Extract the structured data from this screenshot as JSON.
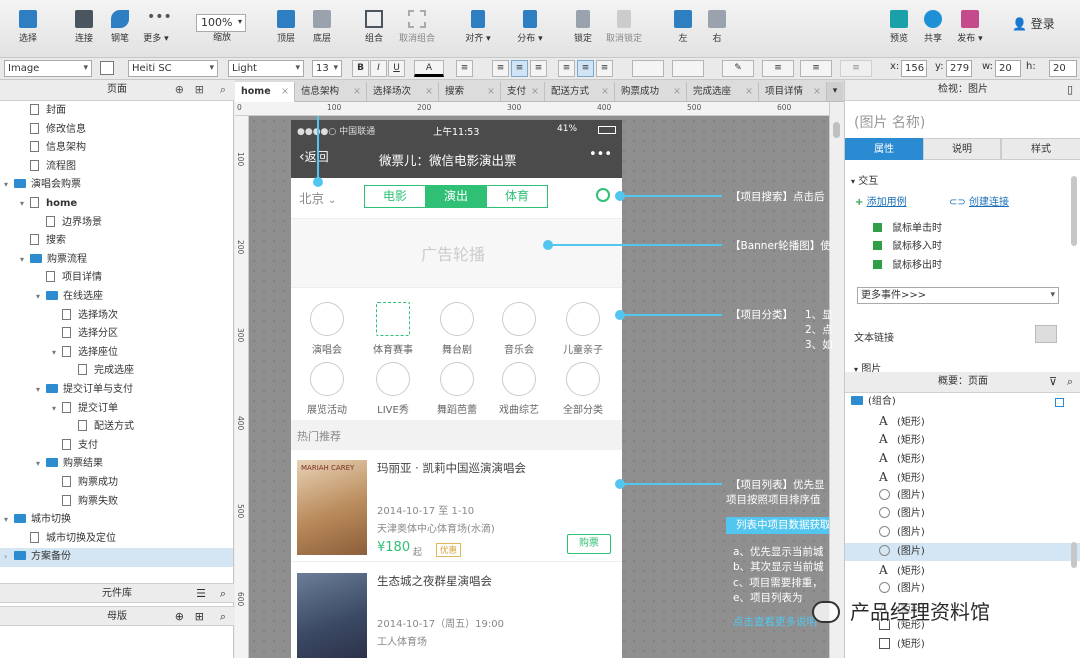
{
  "toolbar": {
    "tools": [
      {
        "label": "选择"
      },
      {
        "label": "连接"
      },
      {
        "label": "钢笔"
      },
      {
        "label": "更多 ▾"
      }
    ],
    "zoom_value": "100%",
    "zoom_label": "缩放",
    "arrange": [
      {
        "label": "顶层"
      },
      {
        "label": "底层"
      },
      {
        "label": "组合"
      },
      {
        "label": "取消组合"
      },
      {
        "label": "对齐 ▾"
      },
      {
        "label": "分布 ▾"
      },
      {
        "label": "锁定"
      },
      {
        "label": "取消锁定"
      },
      {
        "label": "左"
      },
      {
        "label": "右"
      }
    ],
    "actions": [
      {
        "label": "预览"
      },
      {
        "label": "共享"
      },
      {
        "label": "发布 ▾"
      }
    ],
    "login": "登录"
  },
  "format_bar": {
    "widget_type": "Image",
    "font": "Heiti SC",
    "weight": "Light",
    "size": "13",
    "bold": "B",
    "italic": "I",
    "underline": "U",
    "color": "A",
    "x_label": "x:",
    "x": "156",
    "y_label": "y:",
    "y": "279",
    "w_label": "w:",
    "w": "20",
    "h_label": "h:",
    "h": "20"
  },
  "left_panel": {
    "pages_title": "页面",
    "tree": [
      {
        "label": "封面",
        "indent": 1,
        "kind": "page",
        "expand": ""
      },
      {
        "label": "修改信息",
        "indent": 1,
        "kind": "page",
        "expand": ""
      },
      {
        "label": "信息架构",
        "indent": 1,
        "kind": "page",
        "expand": ""
      },
      {
        "label": "流程图",
        "indent": 1,
        "kind": "page",
        "expand": ""
      },
      {
        "label": "演唱会购票",
        "indent": 0,
        "kind": "folder",
        "expand": "▾"
      },
      {
        "label": "home",
        "indent": 1,
        "kind": "page",
        "expand": "▾",
        "bold": true
      },
      {
        "label": "边界场景",
        "indent": 2,
        "kind": "page",
        "expand": ""
      },
      {
        "label": "搜索",
        "indent": 1,
        "kind": "page",
        "expand": ""
      },
      {
        "label": "购票流程",
        "indent": 1,
        "kind": "folder",
        "expand": "▾"
      },
      {
        "label": "项目详情",
        "indent": 2,
        "kind": "page",
        "expand": ""
      },
      {
        "label": "在线选座",
        "indent": 2,
        "kind": "folder",
        "expand": "▾"
      },
      {
        "label": "选择场次",
        "indent": 3,
        "kind": "page",
        "expand": ""
      },
      {
        "label": "选择分区",
        "indent": 3,
        "kind": "page",
        "expand": ""
      },
      {
        "label": "选择座位",
        "indent": 3,
        "kind": "page",
        "expand": "▾"
      },
      {
        "label": "完成选座",
        "indent": 4,
        "kind": "page",
        "expand": ""
      },
      {
        "label": "提交订单与支付",
        "indent": 2,
        "kind": "folder",
        "expand": "▾"
      },
      {
        "label": "提交订单",
        "indent": 3,
        "kind": "page",
        "expand": "▾"
      },
      {
        "label": "配送方式",
        "indent": 4,
        "kind": "page",
        "expand": ""
      },
      {
        "label": "支付",
        "indent": 3,
        "kind": "page",
        "expand": ""
      },
      {
        "label": "购票结果",
        "indent": 2,
        "kind": "folder",
        "expand": "▾"
      },
      {
        "label": "购票成功",
        "indent": 3,
        "kind": "page",
        "expand": ""
      },
      {
        "label": "购票失败",
        "indent": 3,
        "kind": "page",
        "expand": ""
      },
      {
        "label": "城市切换",
        "indent": 0,
        "kind": "folder",
        "expand": "▾"
      },
      {
        "label": "城市切换及定位",
        "indent": 1,
        "kind": "page",
        "expand": ""
      },
      {
        "label": "方案备份",
        "indent": 0,
        "kind": "folder",
        "expand": "›",
        "selected": true
      }
    ],
    "library_title": "元件库",
    "masters_title": "母版"
  },
  "tabs": [
    {
      "label": "home",
      "active": true
    },
    {
      "label": "信息架构"
    },
    {
      "label": "选择场次"
    },
    {
      "label": "搜索"
    },
    {
      "label": "支付"
    },
    {
      "label": "配送方式"
    },
    {
      "label": "购票成功"
    },
    {
      "label": "完成选座"
    },
    {
      "label": "项目详情"
    }
  ],
  "ruler": {
    "h_ticks": [
      "0",
      "100",
      "200",
      "300",
      "400",
      "500",
      "600"
    ],
    "v_ticks": [
      "100",
      "200",
      "300",
      "400",
      "500",
      "600"
    ]
  },
  "phone": {
    "status_carrier": "●●●●○ 中国联通",
    "status_time": "上午11:53",
    "status_battery": "41%",
    "back": "返回",
    "title": "微票儿：微信电影演出票",
    "more": "•••",
    "city": "北京",
    "segments": [
      "电影",
      "演出",
      "体育"
    ],
    "banner": "广告轮播",
    "categories_row1": [
      "演唱会",
      "体育赛事",
      "舞台剧",
      "音乐会",
      "儿童亲子"
    ],
    "categories_row2": [
      "展览活动",
      "LIVE秀",
      "舞蹈芭蕾",
      "戏曲综艺",
      "全部分类"
    ],
    "section": "热门推荐",
    "items": [
      {
        "title": "玛丽亚 · 凯莉中国巡演演唱会",
        "date": "2014-10-17 至 1-10",
        "venue": "天津奥体中心体育场(水滴)",
        "price": "¥180",
        "price_suffix": "起",
        "badge": "优惠",
        "buy": "购票",
        "poster": "MARIAH CAREY"
      },
      {
        "title": "生态城之夜群星演唱会",
        "date": "2014-10-17（周五）19:00",
        "venue": "工人体育场"
      }
    ]
  },
  "annotations": {
    "search": "【项目搜索】点击后",
    "banner": "【Banner轮播图】使",
    "category_title": "【项目分类】",
    "category_lines": [
      "1、显",
      "2、点",
      "3、如"
    ],
    "list_line1": "【项目列表】优先显",
    "list_line2": "项目按照项目排序值",
    "list_box": "列表中项目数据获取",
    "list_rules": [
      "a、优先显示当前城",
      "b、其次显示当前城",
      "c、项目需要排重，",
      "e、项目列表为"
    ],
    "list_link": "点击查看更多说明"
  },
  "watermark": "产品经理资料馆",
  "right_panel": {
    "inspector_title": "检视：图片",
    "image_name": "(图片 名称)",
    "tabs": [
      "属性",
      "说明",
      "样式"
    ],
    "interaction": "交互",
    "add_case": "添加用例",
    "create_link": "创建连接",
    "events": [
      "鼠标单击时",
      "鼠标移入时",
      "鼠标移出时"
    ],
    "more_events": "更多事件>>>",
    "text_link": "文本链接",
    "image_section": "图片",
    "outline_title": "概要：页面",
    "outline": [
      {
        "label": "(组合)",
        "kind": "folder"
      },
      {
        "label": "(矩形)",
        "kind": "A"
      },
      {
        "label": "(矩形)",
        "kind": "A"
      },
      {
        "label": "(矩形)",
        "kind": "A"
      },
      {
        "label": "(矩形)",
        "kind": "A"
      },
      {
        "label": "(图片)",
        "kind": "C"
      },
      {
        "label": "(图片)",
        "kind": "C"
      },
      {
        "label": "(图片)",
        "kind": "C"
      },
      {
        "label": "(图片)",
        "kind": "C",
        "selected": true
      },
      {
        "label": "(矩形)",
        "kind": "A"
      },
      {
        "label": "(图片)",
        "kind": "C"
      },
      {
        "label": "(矩形)",
        "kind": "A"
      },
      {
        "label": "(矩形)",
        "kind": "R"
      },
      {
        "label": "(矩形)",
        "kind": "R"
      }
    ]
  },
  "colors": {
    "accent": "#2a8ad2",
    "phone_green": "#2fc076",
    "annotation": "#53c6ef"
  }
}
